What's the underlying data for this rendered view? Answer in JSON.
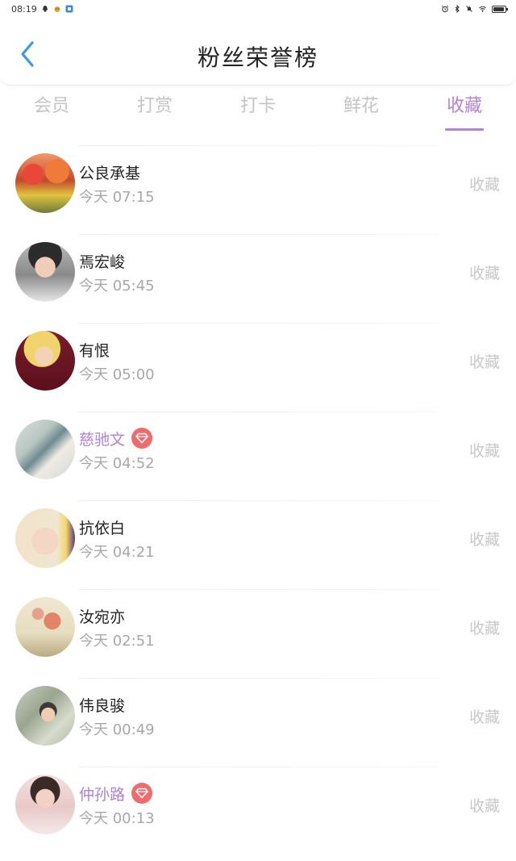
{
  "status_bar": {
    "time": "08:19"
  },
  "header": {
    "title": "粉丝荣誉榜"
  },
  "tabs": [
    {
      "label": "会员",
      "active": false
    },
    {
      "label": "打赏",
      "active": false
    },
    {
      "label": "打卡",
      "active": false
    },
    {
      "label": "鲜花",
      "active": false
    },
    {
      "label": "收藏",
      "active": true
    }
  ],
  "colors": {
    "accent": "#b383d3",
    "vip_name": "#b080d8",
    "vip_badge": "#f06b6b"
  },
  "list": {
    "items": [
      {
        "name": "公良承基",
        "time": "今天 07:15",
        "action": "收藏",
        "vip": false
      },
      {
        "name": "焉宏峻",
        "time": "今天 05:45",
        "action": "收藏",
        "vip": false
      },
      {
        "name": "有恨",
        "time": "今天 05:00",
        "action": "收藏",
        "vip": false
      },
      {
        "name": "慈驰文",
        "time": "今天 04:52",
        "action": "收藏",
        "vip": true
      },
      {
        "name": "抗依白",
        "time": "今天 04:21",
        "action": "收藏",
        "vip": false
      },
      {
        "name": "汝宛亦",
        "time": "今天 02:51",
        "action": "收藏",
        "vip": false
      },
      {
        "name": "伟良骏",
        "time": "今天 00:49",
        "action": "收藏",
        "vip": false
      },
      {
        "name": "仲孙路",
        "time": "今天 00:13",
        "action": "收藏",
        "vip": true
      }
    ]
  }
}
